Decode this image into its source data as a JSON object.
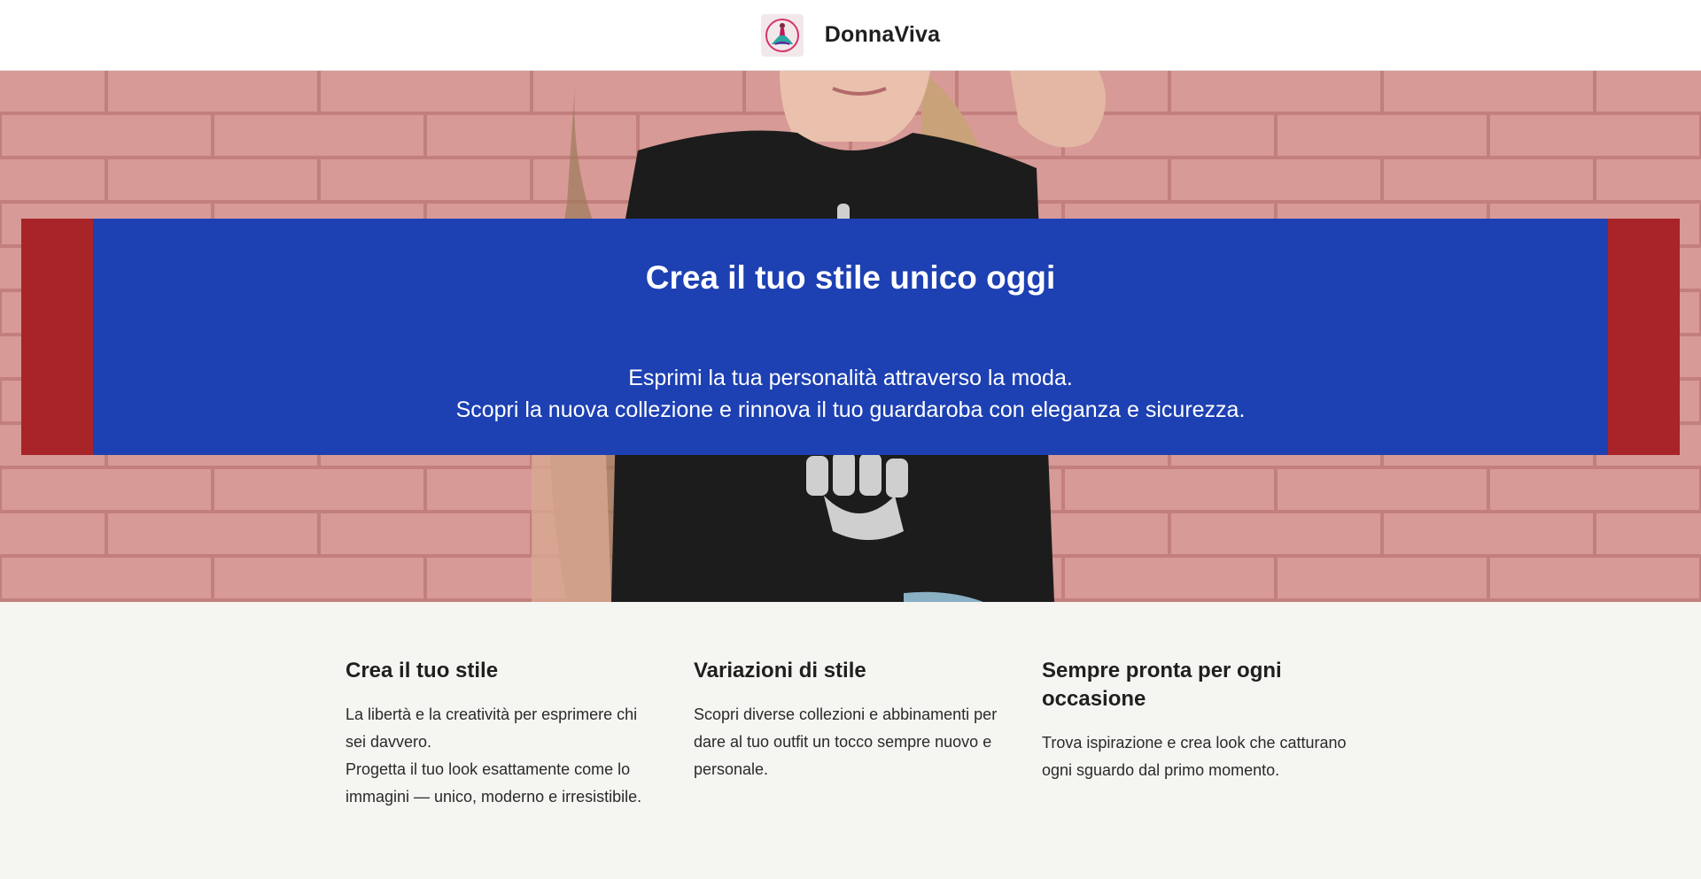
{
  "header": {
    "logo_icon": "woman-fashion-logo-icon",
    "brand": "DonnaViva"
  },
  "hero": {
    "background": "woman-in-black-tshirt-against-pink-brick-wall",
    "title": "Crea il tuo stile unico oggi",
    "subtitle_line1": "Esprimi la tua personalità attraverso la moda.",
    "subtitle_line2": "Scopri la nuova collezione e rinnova il tuo guardaroba con eleganza e sicurezza.",
    "colors": {
      "banner": "#1d40b2",
      "frame": "#a82428",
      "wall": "#d99b97"
    }
  },
  "features": [
    {
      "title": "Crea il tuo stile",
      "text_line1": "La libertà e la creatività per esprimere chi sei davvero.",
      "text_line2": "Progetta il tuo look esattamente come lo immagini — unico, moderno e irresistibile."
    },
    {
      "title": "Variazioni di stile",
      "text_line1": "Scopri diverse collezioni e abbinamenti per dare al tuo outfit un tocco sempre nuovo e personale."
    },
    {
      "title": "Sempre pronta per ogni occasione",
      "text_line1": "Trova ispirazione e crea look che catturano ogni sguardo dal primo momento."
    }
  ]
}
